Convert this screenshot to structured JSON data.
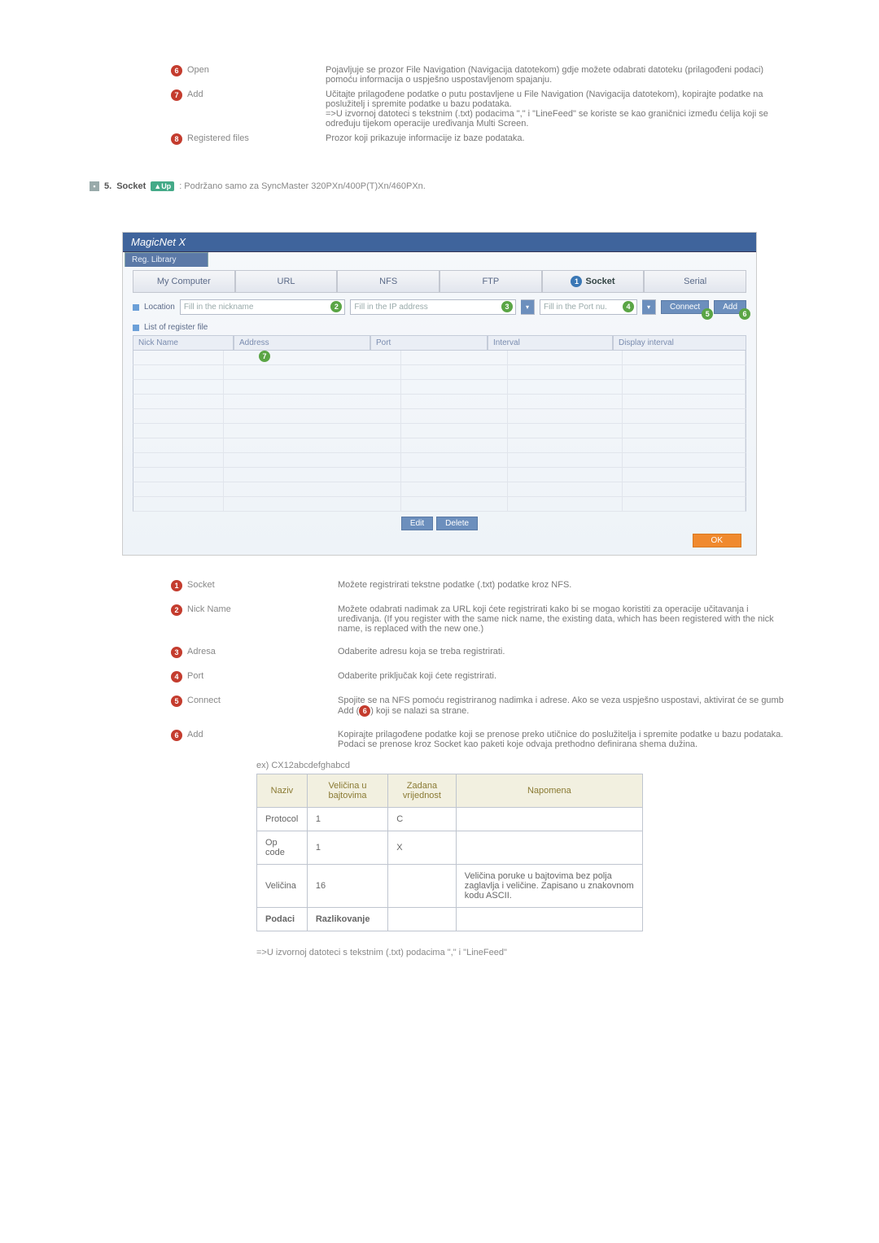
{
  "top": {
    "items": [
      {
        "num": "6",
        "label": "Open",
        "desc": "Pojavljuje se prozor File Navigation (Navigacija datotekom) gdje možete odabrati datoteku (prilagođeni podaci) pomoću informacija o uspješno uspostavljenom spajanju."
      },
      {
        "num": "7",
        "label": "Add",
        "desc": "Učitajte prilagođene podatke o putu postavljene u File Navigation (Navigacija datotekom), kopirajte podatke na poslužitelj i spremite podatke u bazu podataka.\n=>U izvornoj datoteci s tekstnim (.txt) podacima \",\" i \"LineFeed\" se koriste se kao graničnici između ćelija koji se određuju tijekom operacije uređivanja Multi Screen."
      },
      {
        "num": "8",
        "label": "Registered files",
        "desc": "Prozor koji prikazuje informacije iz baze podataka."
      }
    ]
  },
  "section": {
    "num": "5.",
    "title": "Socket",
    "up": "Up",
    "note": ": Podržano samo za SyncMaster 320PXn/400P(T)Xn/460PXn."
  },
  "shot": {
    "app": "MagicNet X",
    "tab": "Reg. Library",
    "tools": [
      "My Computer",
      "URL",
      "NFS",
      "FTP",
      "Socket",
      "Serial"
    ],
    "socket_marker": "1",
    "loc_label": "Location",
    "nick_ph": "Fill in the nickname",
    "nick_marker": "2",
    "ip_ph": "Fill in the IP address",
    "ip_marker": "3",
    "port_ph": "Fill in the Port nu.",
    "port_marker": "4",
    "connect": "Connect",
    "connect_marker": "5",
    "add": "Add",
    "add_marker": "6",
    "list_label": "List of register file",
    "cols": [
      "Nick Name",
      "Address",
      "Port",
      "Interval",
      "Display interval"
    ],
    "addr_marker": "7",
    "edit": "Edit",
    "delete": "Delete",
    "ok": "OK"
  },
  "exp": [
    {
      "num": "1",
      "label": "Socket",
      "desc": "Možete registrirati tekstne podatke (.txt) podatke kroz NFS."
    },
    {
      "num": "2",
      "label": "Nick Name",
      "desc": "Možete odabrati nadimak za URL koji ćete registrirati kako bi se mogao koristiti za operacije učitavanja i uređivanja. (If you register with the same nick name, the existing data, which has been registered with the nick name, is replaced with the new one.)"
    },
    {
      "num": "3",
      "label": "Adresa",
      "desc": "Odaberite adresu koja se treba registrirati."
    },
    {
      "num": "4",
      "label": "Port",
      "desc": "Odaberite priključak koji ćete registrirati."
    },
    {
      "num": "5",
      "label": "Connect",
      "desc_pre": "Spojite se na NFS pomoću registriranog nadimka i adrese. Ako se veza uspješno uspostavi, aktivirat će se gumb Add (",
      "desc_post": ") koji se nalazi sa strane.",
      "inline_num": "6"
    },
    {
      "num": "6",
      "label": "Add",
      "desc": "Kopirajte prilagođene podatke koji se prenose preko utičnice do poslužitelja i spremite podatke u bazu podataka.\nPodaci se prenose kroz Socket kao paketi koje odvaja prethodno definirana shema dužina."
    }
  ],
  "extxt": "ex) CX12abcdefghabcd",
  "thead": [
    "Naziv",
    "Veličina u bajtovima",
    "Zadana vrijednost",
    "Napomena"
  ],
  "rows": [
    {
      "c1": "Protocol",
      "c2": "1",
      "c3": "C",
      "c4": ""
    },
    {
      "c1": "Op code",
      "c2": "1",
      "c3": "X",
      "c4": ""
    },
    {
      "c1": "Veličina",
      "c2": "16",
      "c3": "",
      "c4": "Veličina poruke u bajtovima bez polja zaglavlja i veličine. Zapisano u znakovnom kodu ASCII."
    },
    {
      "c1": "Podaci",
      "c2": "Razlikovanje",
      "c3": "",
      "c4": ""
    }
  ],
  "footnote": "=>U izvornoj datoteci s tekstnim (.txt) podacima \",\" i \"LineFeed\""
}
